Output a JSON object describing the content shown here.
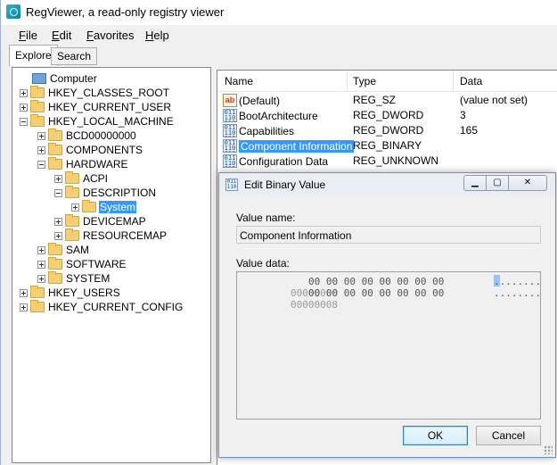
{
  "window": {
    "title": "RegViewer, a read-only registry viewer"
  },
  "menu": {
    "file": "ile",
    "file_u": "F",
    "edit": "dit",
    "edit_u": "E",
    "favorites": "avorites",
    "favorites_u": "F",
    "help": "elp",
    "help_u": "H"
  },
  "tabs": {
    "explore": "Explore",
    "search": "Search"
  },
  "tree": {
    "computer": "Computer",
    "hkcr": "HKEY_CLASSES_ROOT",
    "hkcu": "HKEY_CURRENT_USER",
    "hklm": "HKEY_LOCAL_MACHINE",
    "bcd": "BCD00000000",
    "components": "COMPONENTS",
    "hardware": "HARDWARE",
    "acpi": "ACPI",
    "description": "DESCRIPTION",
    "system_sel": "System",
    "devicemap": "DEVICEMAP",
    "resourcemap": "RESOURCEMAP",
    "sam": "SAM",
    "software": "SOFTWARE",
    "system": "SYSTEM",
    "hku": "HKEY_USERS",
    "hkcc": "HKEY_CURRENT_CONFIG"
  },
  "list": {
    "headers": {
      "name": "Name",
      "type": "Type",
      "data": "Data"
    },
    "rows": [
      {
        "name": "(Default)",
        "type": "REG_SZ",
        "data": "(value not set)",
        "icon": "string-value-icon"
      },
      {
        "name": "BootArchitecture",
        "type": "REG_DWORD",
        "data": "3",
        "icon": "binary-value-icon"
      },
      {
        "name": "Capabilities",
        "type": "REG_DWORD",
        "data": "165",
        "icon": "binary-value-icon"
      },
      {
        "name": "Component Information",
        "type": "REG_BINARY",
        "data": "",
        "icon": "binary-value-icon"
      },
      {
        "name": "Configuration Data",
        "type": "REG_UNKNOWN",
        "data": "",
        "icon": "binary-value-icon"
      }
    ]
  },
  "dialog": {
    "title": "Edit Binary Value",
    "value_name_label": "Value name:",
    "value_name": "Component Information",
    "value_data_label": "Value data:",
    "hex": [
      {
        "addr": "00000000",
        "bytes": "00 00 00 00 00 00 00 00",
        "ascii": "........"
      },
      {
        "addr": "00000008",
        "bytes": "00 00 00 00 00 00 00 00",
        "ascii": "........"
      }
    ],
    "ok": "OK",
    "cancel": "Cancel"
  }
}
